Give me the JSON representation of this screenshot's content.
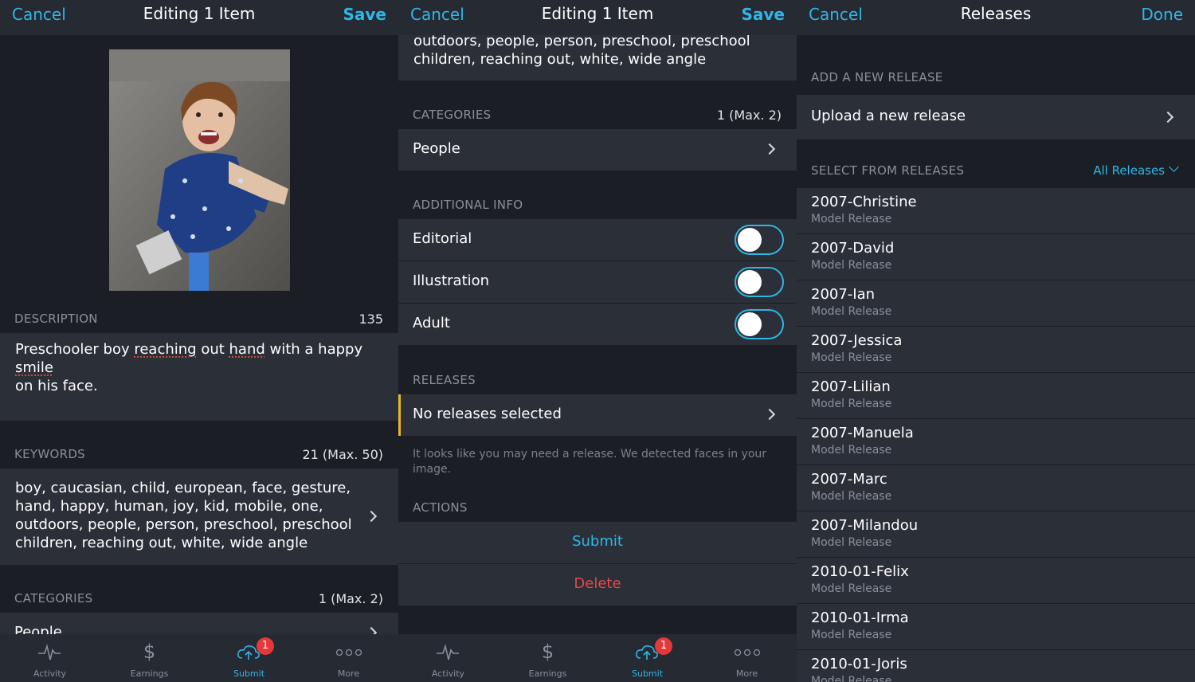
{
  "screen1": {
    "nav": {
      "cancel": "Cancel",
      "title": "Editing 1 Item",
      "save": "Save"
    },
    "description": {
      "header": "DESCRIPTION",
      "count": "135",
      "text_parts": [
        "Preschooler boy ",
        "reaching",
        " out ",
        "hand",
        " with a happy ",
        "smile"
      ],
      "line2": "on his face."
    },
    "keywords": {
      "header": "KEYWORDS",
      "count": "21 (Max. 50)",
      "lines": [
        "boy, caucasian, child, european, face, gesture,",
        "hand, happy, human, joy, kid, mobile, one,",
        "outdoors, people, person, preschool, preschool",
        "children, reaching out, white, wide angle"
      ]
    },
    "categories": {
      "header": "CATEGORIES",
      "count": "1 (Max. 2)",
      "value": "People"
    }
  },
  "screen2": {
    "nav": {
      "cancel": "Cancel",
      "title": "Editing 1 Item",
      "save": "Save"
    },
    "keywords_tail": [
      "outdoors, people, person, preschool, preschool",
      "children, reaching out, white, wide angle"
    ],
    "categories": {
      "header": "CATEGORIES",
      "count": "1 (Max. 2)",
      "value": "People"
    },
    "additional": {
      "header": "ADDITIONAL INFO",
      "items": [
        "Editorial",
        "Illustration",
        "Adult"
      ]
    },
    "releases": {
      "header": "RELEASES",
      "value": "No releases selected",
      "hint_line1": "It looks like you may need a release. We detected faces in your",
      "hint_line2": "image."
    },
    "actions": {
      "header": "ACTIONS",
      "submit": "Submit",
      "delete": "Delete"
    }
  },
  "screen3": {
    "nav": {
      "cancel": "Cancel",
      "title": "Releases",
      "done": "Done"
    },
    "add_header": "ADD A NEW RELEASE",
    "upload": "Upload a new release",
    "select_header": "SELECT FROM RELEASES",
    "filter": "All Releases",
    "releases": [
      {
        "name": "2007-Christine",
        "type": "Model Release"
      },
      {
        "name": "2007-David",
        "type": "Model Release"
      },
      {
        "name": "2007-Ian",
        "type": "Model Release"
      },
      {
        "name": "2007-Jessica",
        "type": "Model Release"
      },
      {
        "name": "2007-Lilian",
        "type": "Model Release"
      },
      {
        "name": "2007-Manuela",
        "type": "Model Release"
      },
      {
        "name": "2007-Marc",
        "type": "Model Release"
      },
      {
        "name": "2007-Milandou",
        "type": "Model Release"
      },
      {
        "name": "2010-01-Felix",
        "type": "Model Release"
      },
      {
        "name": "2010-01-Irma",
        "type": "Model Release"
      },
      {
        "name": "2010-01-Joris",
        "type": "Model Release"
      }
    ]
  },
  "tabbar": {
    "tabs": [
      {
        "label": "Activity",
        "icon": "activity-icon"
      },
      {
        "label": "Earnings",
        "icon": "dollar-icon"
      },
      {
        "label": "Submit",
        "icon": "cloud-upload-icon"
      },
      {
        "label": "More",
        "icon": "more-icon"
      }
    ],
    "badge": "1"
  },
  "colors": {
    "accent": "#2fb7e6",
    "danger": "#e5484d",
    "warning": "#e8b923"
  }
}
